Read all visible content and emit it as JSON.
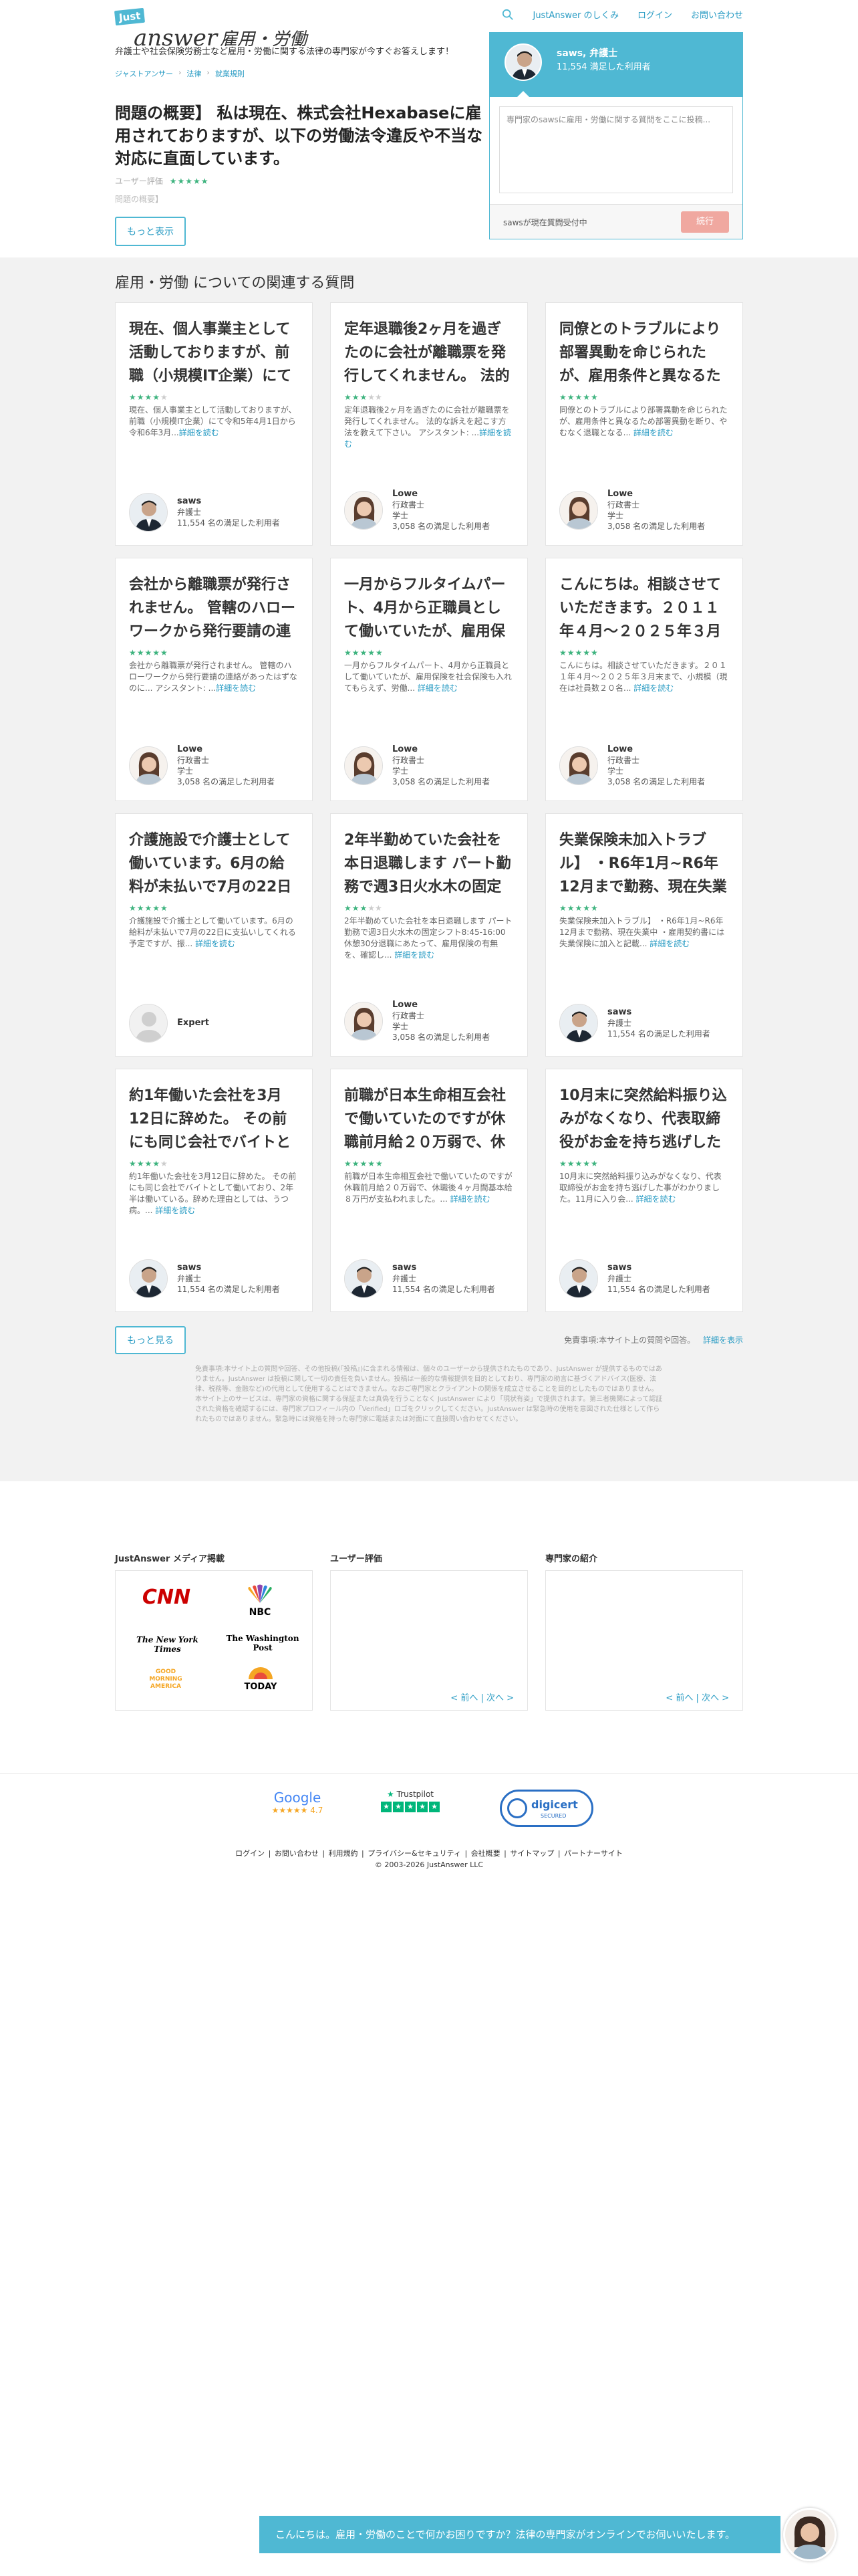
{
  "header": {
    "logo_just": "Just",
    "logo_answer": "answer",
    "logo_category": "雇用・労働",
    "tagline": "弁護士や社会保険労務士など雇用・労働に関する法律の専門家が今すぐお答えします！",
    "nav": [
      "JustAnswer のしくみ",
      "ログイン",
      "お問い合わせ"
    ]
  },
  "breadcrumb": [
    "ジャストアンサー",
    "法律",
    "就業規則"
  ],
  "question": {
    "title": "問題の概要】 私は現在、株式会社Hexabaseに雇用されておりますが、以下の労働法令違反や不当な対応に直面しています。",
    "meta_label": "ユーザー評価",
    "summary_label": "問題の概要】",
    "more_label": "もっと表示"
  },
  "chat_widget": {
    "expert_name": "saws, 弁護士",
    "expert_sub": "11,554 満足した利用者",
    "placeholder": "専門家のsawsに雇用・労働に関する質問をここに投稿...",
    "status": "sawsが現在質問受付中",
    "button": "続行"
  },
  "related": {
    "title": "雇用・労働 についての関連する質問",
    "more_link": "詳細を読む",
    "cards": [
      {
        "title": "現在、個人事業主として活動しておりますが、前職（小規模IT企業）にて",
        "rating": 4,
        "body": "現在、個人事業主として活動しておりますが、前職（小規模IT企業）にて令和5年4月1日から令和6年3月...",
        "expert": "saws",
        "role": "弁護士",
        "role2": "",
        "stats": "11,554 名の満足した利用者",
        "avatar": "m"
      },
      {
        "title": "定年退職後2ヶ月を過ぎたのに会社が離職票を発行してくれません。 法的な",
        "rating": 3,
        "body": "定年退職後2ヶ月を過ぎたのに会社が離職票を発行してくれません。 法的な訴えを起こす方法を教えて下さい。 アシスタント: ...",
        "expert": "Lowe",
        "role": "行政書士",
        "role2": "学士",
        "stats": "3,058 名の満足した利用者",
        "avatar": "f"
      },
      {
        "title": "同僚とのトラブルにより部署異動を命じられたが、雇用条件と異なるた",
        "rating": 5,
        "body": "同僚とのトラブルにより部署異動を命じられたが、雇用条件と異なるため部署異動を断り、やむなく退職となる... ",
        "expert": "Lowe",
        "role": "行政書士",
        "role2": "学士",
        "stats": "3,058 名の満足した利用者",
        "avatar": "f"
      },
      {
        "title": "会社から離職票が発行されません。 管轄のハローワークから発行要請の連",
        "rating": 5,
        "body": "会社から離職票が発行されません。 管轄のハローワークから発行要請の連絡があったはずなのに... アシスタント: ...",
        "expert": "Lowe",
        "role": "行政書士",
        "role2": "学士",
        "stats": "3,058 名の満足した利用者",
        "avatar": "f"
      },
      {
        "title": "一月からフルタイムパート、4月から正職員として働いていたが、雇用保険",
        "rating": 5,
        "body": "一月からフルタイムパート、4月から正職員として働いていたが、雇用保険を社会保険も入れてもらえず、労働... ",
        "expert": "Lowe",
        "role": "行政書士",
        "role2": "学士",
        "stats": "3,058 名の満足した利用者",
        "avatar": "f"
      },
      {
        "title": "こんにちは。相談させていただきます。２０１１年４月～２０２５年３月",
        "rating": 5,
        "body": "こんにちは。相談させていただきます。２０１１年４月～２０２５年３月末まで、小規模（現在は社員数２０名... ",
        "expert": "Lowe",
        "role": "行政書士",
        "role2": "学士",
        "stats": "3,058 名の満足した利用者",
        "avatar": "f"
      },
      {
        "title": "介護施設で介護士として働いています。6月の給料が未払いで7月の22日に",
        "rating": 5,
        "body": "介護施設で介護士として働いています。6月の給料が未払いで7月の22日に支払いしてくれる予定ですが、振... ",
        "expert": "Expert",
        "role": "",
        "role2": "",
        "stats": "",
        "avatar": "g"
      },
      {
        "title": "2年半勤めていた会社を本日退職します パート勤務で週3日火水木の固定シフ",
        "rating": 3,
        "body": "2年半勤めていた会社を本日退職します パート勤務で週3日火水木の固定シフト8:45-16:00 休憩30分退職にあたって、雇用保険の有無を、確認し... ",
        "expert": "Lowe",
        "role": "行政書士",
        "role2": "学士",
        "stats": "3,058 名の満足した利用者",
        "avatar": "f"
      },
      {
        "title": "失業保険未加入トラブル】 ・R6年1月~R6年12月まで勤務、現在失業",
        "rating": 5,
        "body": "失業保険未加入トラブル】 ・R6年1月~R6年12月まで勤務、現在失業中 ・雇用契約書には失業保険に加入と記載... ",
        "expert": "saws",
        "role": "弁護士",
        "role2": "",
        "stats": "11,554 名の満足した利用者",
        "avatar": "m"
      },
      {
        "title": "約1年働いた会社を3月12日に辞めた。 その前にも同じ会社でバイトとして",
        "rating": 4,
        "body": "約1年働いた会社を3月12日に辞めた。 その前にも同じ会社でバイトとして働いており、2年半は働いている。辞めた理由としては、うつ病。... ",
        "expert": "saws",
        "role": "弁護士",
        "role2": "",
        "stats": "11,554 名の満足した利用者",
        "avatar": "m"
      },
      {
        "title": "前職が日本生命相互会社で働いていたのですが休職前月給２０万弱で、休",
        "rating": 5,
        "body": "前職が日本生命相互会社で働いていたのですが休職前月給２０万弱で、休職後４ヶ月間基本給８万円が支払われました。... ",
        "expert": "saws",
        "role": "弁護士",
        "role2": "",
        "stats": "11,554 名の満足した利用者",
        "avatar": "m"
      },
      {
        "title": "10月末に突然給料振り込みがなくなり、代表取締役がお金を持ち逃げした",
        "rating": 5,
        "body": "10月末に突然給料振り込みがなくなり、代表取締役がお金を持ち逃げした事がわかりました。11月に入り会... ",
        "expert": "saws",
        "role": "弁護士",
        "role2": "",
        "stats": "11,554 名の満足した利用者",
        "avatar": "m"
      }
    ],
    "show_more": "もっと見る",
    "disclaimer_head": "免責事項:本サイト上の質問や回答。",
    "disclaimer_link": "詳細を表示",
    "disclaimer": "免責事項:本サイト上の質問や回答、その他投稿(『投稿』)に含まれる情報は、個々のユーザーから提供されたものであり、JustAnswer が提供するものではありません。JustAnswer は投稿に関して一切の責任を負いません。投稿は一般的な情報提供を目的としており、専門家の助言に基づくアドバイス(医療、法律、税務等、金融など)の代用として使用することはできません。なおご専門家とクライアントの関係を成立させることを目的としたものではありません。本サイト上のサービスは、専門家の資格に関する保証または真偽を行うことなく JustAnswer により「現状有姿」で提供されます。第三者機関によって認証された資格を確認するには、専門家プロフィール内の「Verified」ロゴをクリックしてください。JustAnswer は緊急時の使用を意図された仕様として作られたものではありません。緊急時には資格を持った専門家に電話または対面にて直接問い合わせてください。"
  },
  "panels": {
    "media_label": "JustAnswer メディア掲載",
    "review_label": "ユーザー評価",
    "expert_label": "専門家の紹介",
    "media": [
      "CNN",
      "NBC",
      "The New York Times",
      "The Washington Post",
      "GOOD MORNING AMERICA",
      "TODAY"
    ],
    "pager": "< 前へ | 次へ >"
  },
  "footer": {
    "google": "Google",
    "google_rating": "4.7",
    "trustpilot": "Trustpilot",
    "digicert": "digicert",
    "digicert_sub": "SECURED",
    "links": [
      "ログイン",
      "お問い合わせ",
      "利用規約",
      "プライバシー&セキュリティ",
      "会社概要",
      "サイトマップ",
      "パートナーサイト"
    ],
    "copyright": "© 2003-2026 JustAnswer LLC"
  },
  "chatbar": {
    "text": "こんにちは。雇用・労働のことで何かお困りですか？法律の専門家がオンラインでお伺いいたします。"
  },
  "colors": {
    "accent": "#4fb8d3",
    "link": "#2a9cc4",
    "star": "#3db37e",
    "cta": "#f0a8a0"
  }
}
